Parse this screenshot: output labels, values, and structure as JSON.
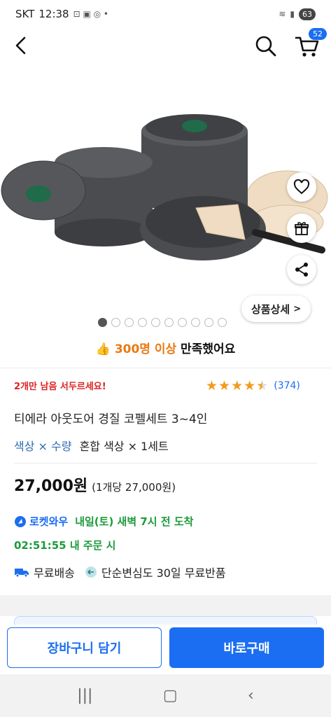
{
  "status_bar": {
    "carrier": "SKT",
    "time": "12:38",
    "battery": "63"
  },
  "header": {
    "cart_count": "52"
  },
  "hero": {
    "detail_button": "상품상세",
    "detail_chevron": ">",
    "image_count": 10,
    "active_index": 0
  },
  "satisfaction": {
    "count_text": "300명 이상",
    "suffix": " 만족했어요"
  },
  "product": {
    "urgency": "2개만 남음 서두르세요!",
    "rating": 4.5,
    "review_count": "(374)",
    "title": "티에라 아웃도어 경질 코펠세트 3~4인",
    "option_label": "색상 × 수량",
    "option_value": "혼합 색상 × 1세트",
    "price": "27,000원",
    "unit_price": "(1개당 27,000원)"
  },
  "delivery": {
    "rocket_label": "로켓와우",
    "arrival": "내일(토) 새벽 7시 전 도착",
    "countdown": "02:51:55 내 주문 시",
    "shipping": "무료배송",
    "return_policy": "단순변심도 30일 무료반품"
  },
  "actions": {
    "add_to_cart": "장바구니 담기",
    "buy_now": "바로구매"
  },
  "colors": {
    "accent": "#1b6ef2",
    "star": "#f29a1c",
    "urgent": "#dd2222",
    "arrival": "#1d9a3a"
  }
}
